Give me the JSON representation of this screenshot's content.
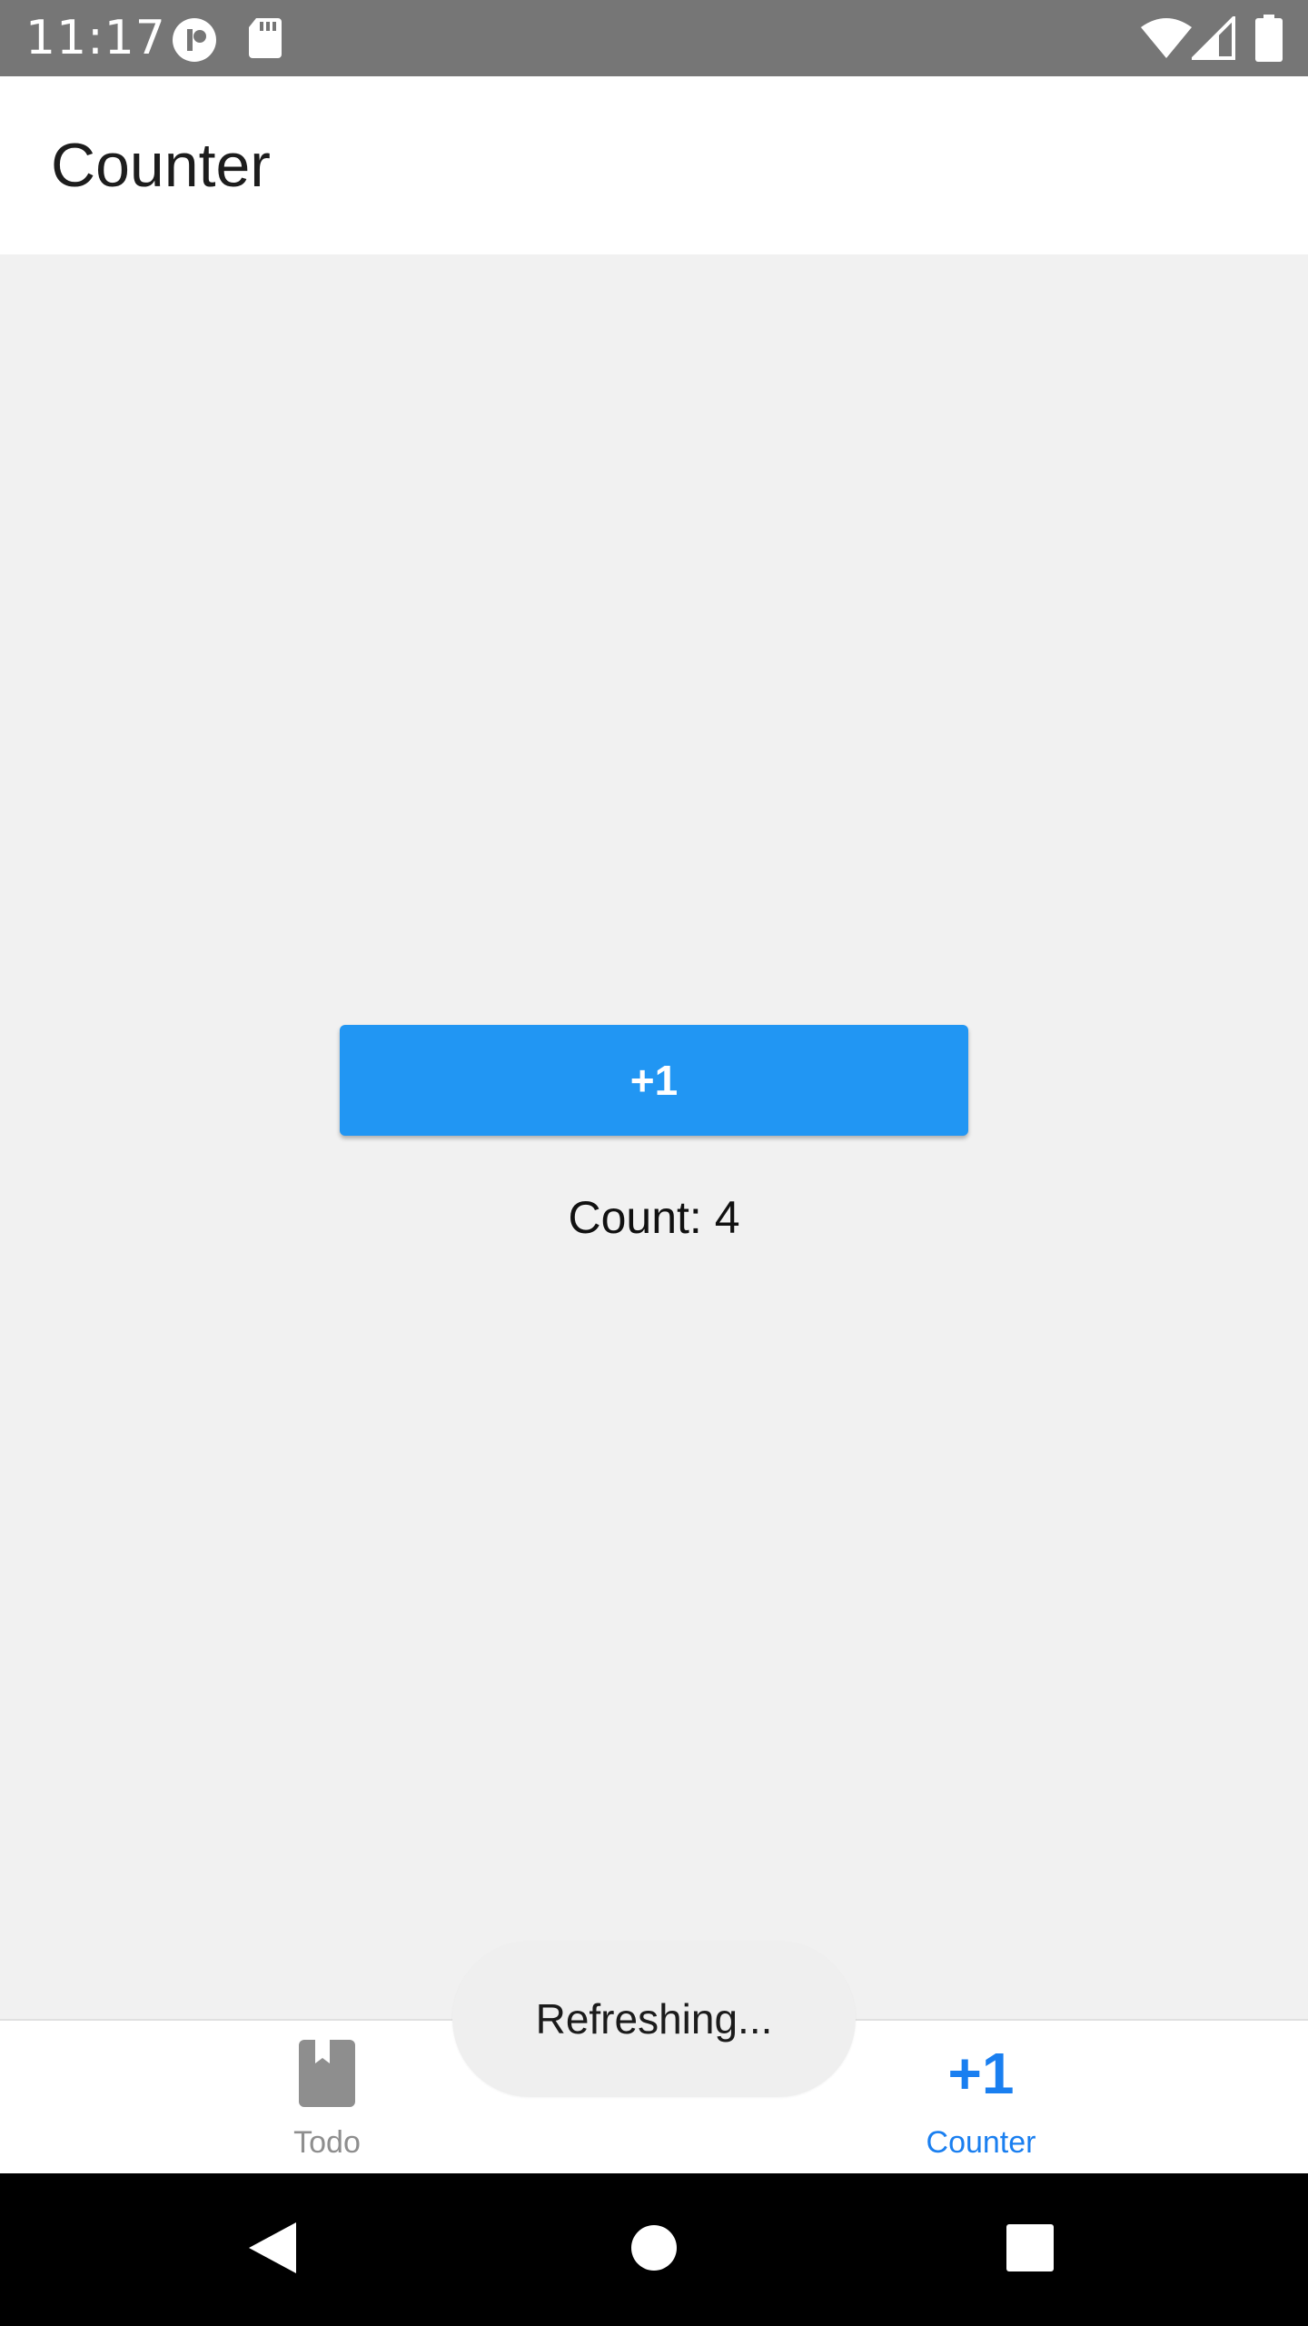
{
  "status_bar": {
    "time": "11:17",
    "icons": [
      "notification-app-icon",
      "sd-card-icon",
      "wifi-icon",
      "cell-signal-icon",
      "battery-icon"
    ]
  },
  "app_bar": {
    "title": "Counter"
  },
  "counter": {
    "button_label": "+1",
    "count_text": "Count: 4",
    "accent_color": "#2196f3"
  },
  "toast": {
    "message": "Refreshing..."
  },
  "tabs": [
    {
      "label": "Todo",
      "icon": "bookmark-icon",
      "active": false
    },
    {
      "label": "Counter",
      "icon_text": "+1",
      "active": true,
      "active_color": "#1a7ff0"
    }
  ],
  "nav_bar": {
    "buttons": [
      "back-icon",
      "home-icon",
      "recents-icon"
    ]
  }
}
